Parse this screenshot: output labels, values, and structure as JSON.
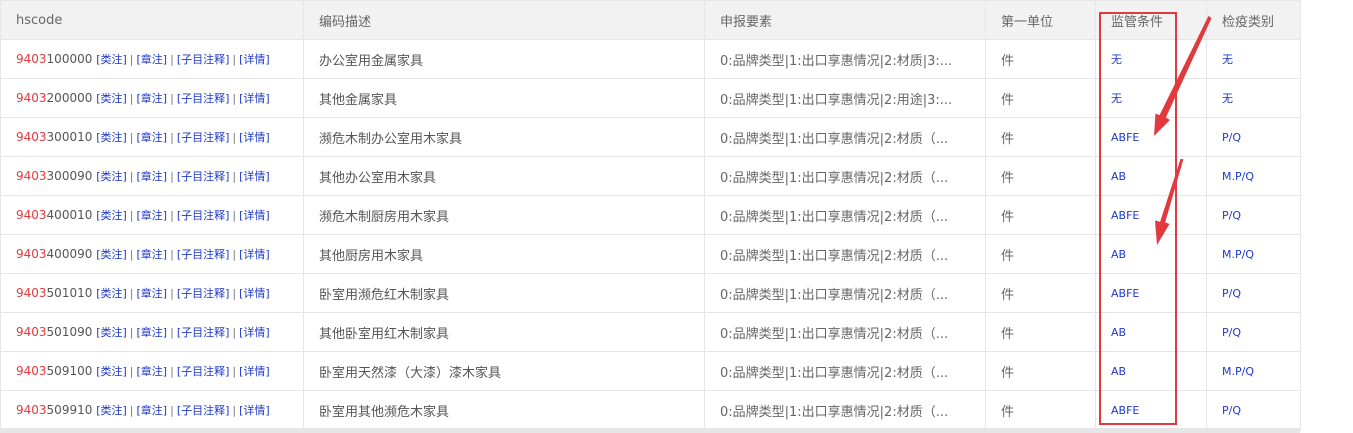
{
  "table": {
    "headers": {
      "hscode": "hscode",
      "description": "编码描述",
      "elements": "申报要素",
      "unit": "第一单位",
      "supervision": "监管条件",
      "inspection": "检疫类别"
    },
    "link_labels": {
      "category_note": "[类注]",
      "chapter_note": "[章注]",
      "subheading_note": "[子目注释]",
      "details": "[详情]",
      "separator": "|"
    },
    "rows": [
      {
        "prefix": "9403",
        "suffix": "100000",
        "description": "办公室用金属家具",
        "elements": "0:品牌类型|1:出口享惠情况|2:材质|3:...",
        "unit": "件",
        "supervision": "无",
        "inspection": "无"
      },
      {
        "prefix": "9403",
        "suffix": "200000",
        "description": "其他金属家具",
        "elements": "0:品牌类型|1:出口享惠情况|2:用途|3:...",
        "unit": "件",
        "supervision": "无",
        "inspection": "无"
      },
      {
        "prefix": "9403",
        "suffix": "300010",
        "description": "濒危木制办公室用木家具",
        "elements": "0:品牌类型|1:出口享惠情况|2:材质（...",
        "unit": "件",
        "supervision": "ABFE",
        "inspection": "P/Q"
      },
      {
        "prefix": "9403",
        "suffix": "300090",
        "description": "其他办公室用木家具",
        "elements": "0:品牌类型|1:出口享惠情况|2:材质（...",
        "unit": "件",
        "supervision": "AB",
        "inspection": "M.P/Q"
      },
      {
        "prefix": "9403",
        "suffix": "400010",
        "description": "濒危木制厨房用木家具",
        "elements": "0:品牌类型|1:出口享惠情况|2:材质（...",
        "unit": "件",
        "supervision": "ABFE",
        "inspection": "P/Q"
      },
      {
        "prefix": "9403",
        "suffix": "400090",
        "description": "其他厨房用木家具",
        "elements": "0:品牌类型|1:出口享惠情况|2:材质（...",
        "unit": "件",
        "supervision": "AB",
        "inspection": "M.P/Q"
      },
      {
        "prefix": "9403",
        "suffix": "501010",
        "description": "卧室用濒危红木制家具",
        "elements": "0:品牌类型|1:出口享惠情况|2:材质（...",
        "unit": "件",
        "supervision": "ABFE",
        "inspection": "P/Q"
      },
      {
        "prefix": "9403",
        "suffix": "501090",
        "description": "其他卧室用红木制家具",
        "elements": "0:品牌类型|1:出口享惠情况|2:材质（...",
        "unit": "件",
        "supervision": "AB",
        "inspection": "P/Q"
      },
      {
        "prefix": "9403",
        "suffix": "509100",
        "description": "卧室用天然漆（大漆）漆木家具",
        "elements": "0:品牌类型|1:出口享惠情况|2:材质（...",
        "unit": "件",
        "supervision": "AB",
        "inspection": "M.P/Q"
      },
      {
        "prefix": "9403",
        "suffix": "509910",
        "description": "卧室用其他濒危木家具",
        "elements": "0:品牌类型|1:出口享惠情况|2:材质（...",
        "unit": "件",
        "supervision": "ABFE",
        "inspection": "P/Q"
      }
    ]
  },
  "colors": {
    "code_prefix": "#e4393c",
    "link": "#1e39c8",
    "annotation": "#e0393e",
    "header_bg": "#f2f2f2"
  }
}
